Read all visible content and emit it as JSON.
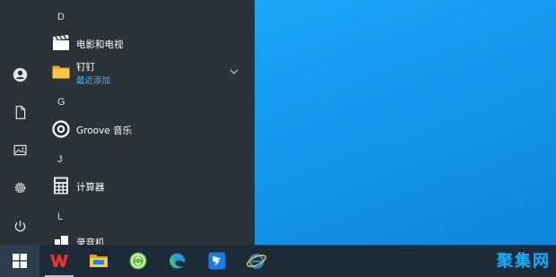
{
  "start_menu": {
    "sections": [
      {
        "letter": "D",
        "apps": [
          {
            "label": "电影和电视",
            "icon": "clapperboard-icon"
          },
          {
            "label": "钉钉",
            "sublabel": "最近添加",
            "icon": "folder-icon",
            "expandable": true
          }
        ]
      },
      {
        "letter": "G",
        "apps": [
          {
            "label": "Groove 音乐",
            "icon": "groove-music-icon"
          }
        ]
      },
      {
        "letter": "J",
        "apps": [
          {
            "label": "计算器",
            "icon": "calculator-icon"
          }
        ]
      },
      {
        "letter": "L",
        "apps": [
          {
            "label": "录音机",
            "icon": "voice-recorder-icon"
          }
        ]
      }
    ],
    "rail_icons": [
      "user-avatar-icon",
      "document-icon",
      "pictures-icon",
      "settings-gear-icon",
      "power-icon"
    ]
  },
  "taskbar": {
    "apps": [
      "windows-start-icon",
      "wps-office-icon",
      "file-explorer-icon",
      "green-app-icon",
      "edge-icon",
      "dingtalk-icon",
      "internet-explorer-icon"
    ],
    "watermark": "聚集网"
  },
  "colors": {
    "menu_bg": "#2b3338",
    "accent_text": "#4ab0f5",
    "taskbar_bg": "#1d2b38",
    "desktop_blue": "#169cf0"
  }
}
